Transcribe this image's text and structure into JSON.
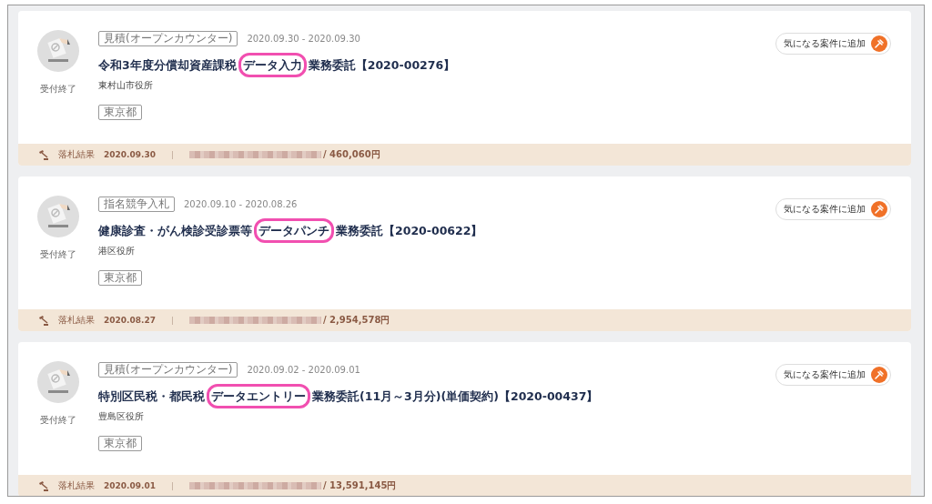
{
  "listings": [
    {
      "status": "受付終了",
      "type_tag": "見積(オープンカウンター)",
      "period": "2020.09.30 - 2020.09.30",
      "title_before": "令和3年度分償却資産課税",
      "title_marked": "データ入力",
      "title_after": "業務委託【2020-00276】",
      "organization": "東村山市役所",
      "prefecture": "東京都",
      "watch_button": "気になる案件に追加",
      "result_label": "落札結果",
      "result_date": "2020.09.30",
      "result_amount": "/ 460,060円"
    },
    {
      "status": "受付終了",
      "type_tag": "指名競争入札",
      "period": "2020.09.10 - 2020.08.26",
      "title_before": "健康診査・がん検診受診票等",
      "title_marked": "データパンチ",
      "title_after": "業務委託【2020-00622】",
      "organization": "港区役所",
      "prefecture": "東京都",
      "watch_button": "気になる案件に追加",
      "result_label": "落札結果",
      "result_date": "2020.08.27",
      "result_amount": "/ 2,954,578円"
    },
    {
      "status": "受付終了",
      "type_tag": "見積(オープンカウンター)",
      "period": "2020.09.02 - 2020.09.01",
      "title_before": "特別区民税・都民税",
      "title_marked": "データエントリー",
      "title_after": "業務委託(11月～3月分)(単価契約)【2020-00437】",
      "organization": "豊島区役所",
      "prefecture": "東京都",
      "watch_button": "気になる案件に追加",
      "result_label": "落札結果",
      "result_date": "2020.09.01",
      "result_amount": "/ 13,591,145円"
    }
  ]
}
